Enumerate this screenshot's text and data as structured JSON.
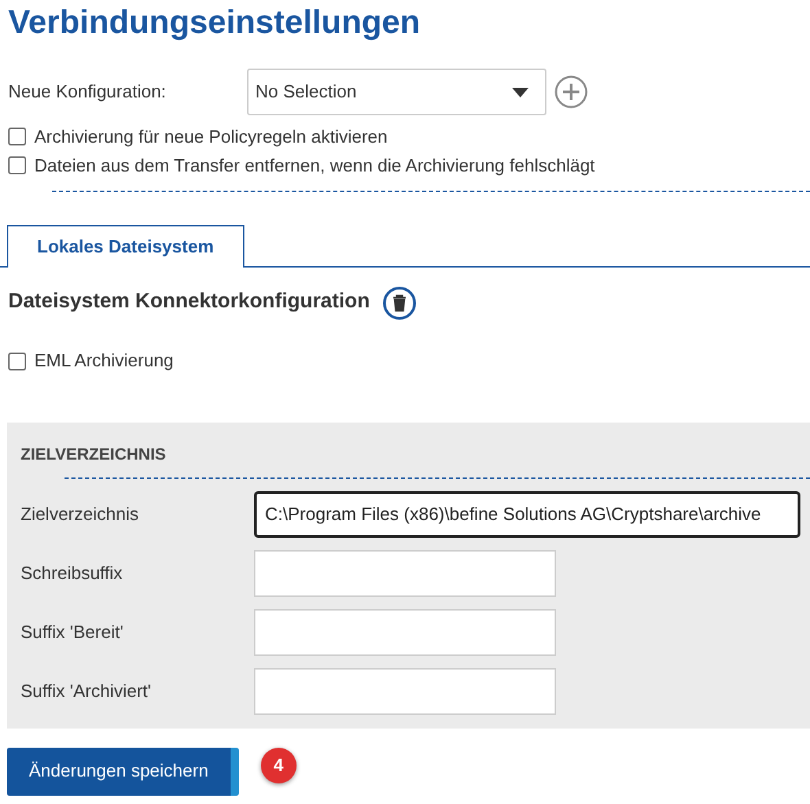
{
  "title": "Verbindungseinstellungen",
  "new_config": {
    "label": "Neue Konfiguration:",
    "select_value": "No Selection"
  },
  "options": [
    {
      "label": "Archivierung für neue Policyregeln aktivieren",
      "checked": false
    },
    {
      "label": "Dateien aus dem Transfer entfernen, wenn die Archivierung fehlschlägt",
      "checked": false
    }
  ],
  "tabs": [
    {
      "label": "Lokales Dateisystem",
      "selected": true
    }
  ],
  "connector": {
    "heading": "Dateisystem Konnektorkonfiguration",
    "options": [
      {
        "label": "EML Archivierung",
        "checked": false
      }
    ]
  },
  "section": {
    "heading": "ZIELVERZEICHNIS",
    "fields": [
      {
        "label": "Zielverzeichnis",
        "value": "C:\\Program Files (x86)\\befine Solutions AG\\Cryptshare\\archive",
        "focused": true
      },
      {
        "label": "Schreibsuffix",
        "focused": false
      },
      {
        "label": "Suffix 'Bereit'",
        "focused": false
      },
      {
        "label": "Suffix 'Archiviert'",
        "focused": false
      }
    ]
  },
  "save_button": "Änderungen speichern",
  "step_badge": "4"
}
